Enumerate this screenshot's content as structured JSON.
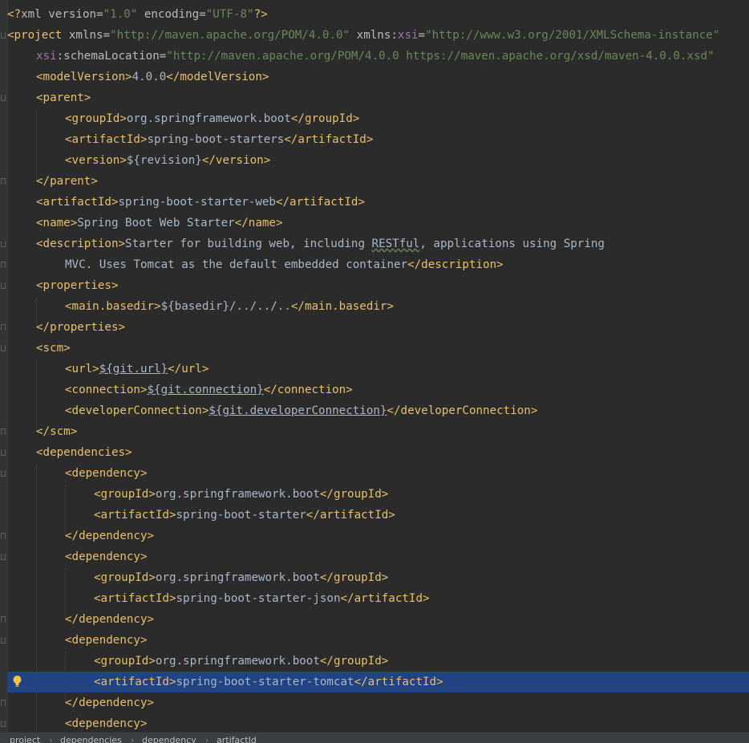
{
  "editor": {
    "lines": {
      "l1": {
        "a": "<?",
        "b": "xml ",
        "c": "version",
        "d": "=",
        "e": "\"1.0\"",
        "f": " ",
        "g": "encoding",
        "h": "=",
        "i": "\"UTF-8\"",
        "j": "?>"
      },
      "l2": {
        "a": "<project ",
        "b": "xmlns",
        "c": "=",
        "d": "\"http://maven.apache.org/POM/4.0.0\"",
        "e": " xmlns",
        "f": ":",
        "g": "xsi",
        "h": "=",
        "i": "\"http://www.w3.org/2001/XMLSchema-instance\""
      },
      "l3": {
        "a": "xsi",
        "b": ":schemaLocation",
        "c": "=",
        "d": "\"http://maven.apache.org/POM/4.0.0 https://maven.apache.org/xsd/maven-4.0.0.xsd\""
      },
      "l4": {
        "a": "<modelVersion>",
        "b": "4.0.0",
        "c": "</modelVersion>"
      },
      "l5": {
        "a": "<parent>"
      },
      "l6": {
        "a": "<groupId>",
        "b": "org.springframework.boot",
        "c": "</groupId>"
      },
      "l7": {
        "a": "<artifactId>",
        "b": "spring-boot-starters",
        "c": "</artifactId>"
      },
      "l8": {
        "a": "<version>",
        "b": "${revision}",
        "c": "</version>"
      },
      "l9": {
        "a": "</parent>"
      },
      "l10": {
        "a": "<artifactId>",
        "b": "spring-boot-starter-web",
        "c": "</artifactId>"
      },
      "l11": {
        "a": "<name>",
        "b": "Spring Boot Web Starter",
        "c": "</name>"
      },
      "l12": {
        "a": "<description>",
        "b": "Starter for building web, including ",
        "c": "RESTful",
        "d": ", applications using Spring"
      },
      "l13": {
        "a": "MVC. Uses Tomcat as the default embedded container",
        "b": "</description>"
      },
      "l14": {
        "a": "<properties>"
      },
      "l15": {
        "a": "<main.basedir>",
        "b": "${basedir}/../../..",
        "c": "</main.basedir>"
      },
      "l16": {
        "a": "</properties>"
      },
      "l17": {
        "a": "<scm>"
      },
      "l18": {
        "a": "<url>",
        "b": "${git.url}",
        "c": "</url>"
      },
      "l19": {
        "a": "<connection>",
        "b": "${git.connection}",
        "c": "</connection>"
      },
      "l20": {
        "a": "<developerConnection>",
        "b": "${git.developerConnection}",
        "c": "</developerConnection>"
      },
      "l21": {
        "a": "</scm>"
      },
      "l22": {
        "a": "<dependencies>"
      },
      "l23": {
        "a": "<dependency>"
      },
      "l24": {
        "a": "<groupId>",
        "b": "org.springframework.boot",
        "c": "</groupId>"
      },
      "l25": {
        "a": "<artifactId>",
        "b": "spring-boot-starter",
        "c": "</artifactId>"
      },
      "l26": {
        "a": "</dependency>"
      },
      "l27": {
        "a": "<dependency>"
      },
      "l28": {
        "a": "<groupId>",
        "b": "org.springframework.boot",
        "c": "</groupId>"
      },
      "l29": {
        "a": "<artifactId>",
        "b": "spring-boot-starter-json",
        "c": "</artifactId>"
      },
      "l30": {
        "a": "</dependency>"
      },
      "l31": {
        "a": "<dependency>"
      },
      "l32": {
        "a": "<groupId>",
        "b": "org.springframework.boot",
        "c": "</groupId>"
      },
      "l33": {
        "a": "<artifactId>",
        "b": "spring-boot-starter-tomcat",
        "c": "</artifactId>"
      },
      "l34": {
        "a": "</dependency>"
      },
      "l35": {
        "a": "<dependency>"
      }
    },
    "intention_icon": "lightbulb-icon"
  },
  "breadcrumb": {
    "items": [
      "project",
      "dependencies",
      "dependency",
      "artifactId"
    ],
    "separator": "›"
  },
  "colors": {
    "background": "#2b2b2b",
    "tag": "#e8bf6a",
    "attribute_value": "#6a8759",
    "namespace": "#9876aa",
    "text": "#a9b7c6",
    "selection": "#214283"
  }
}
